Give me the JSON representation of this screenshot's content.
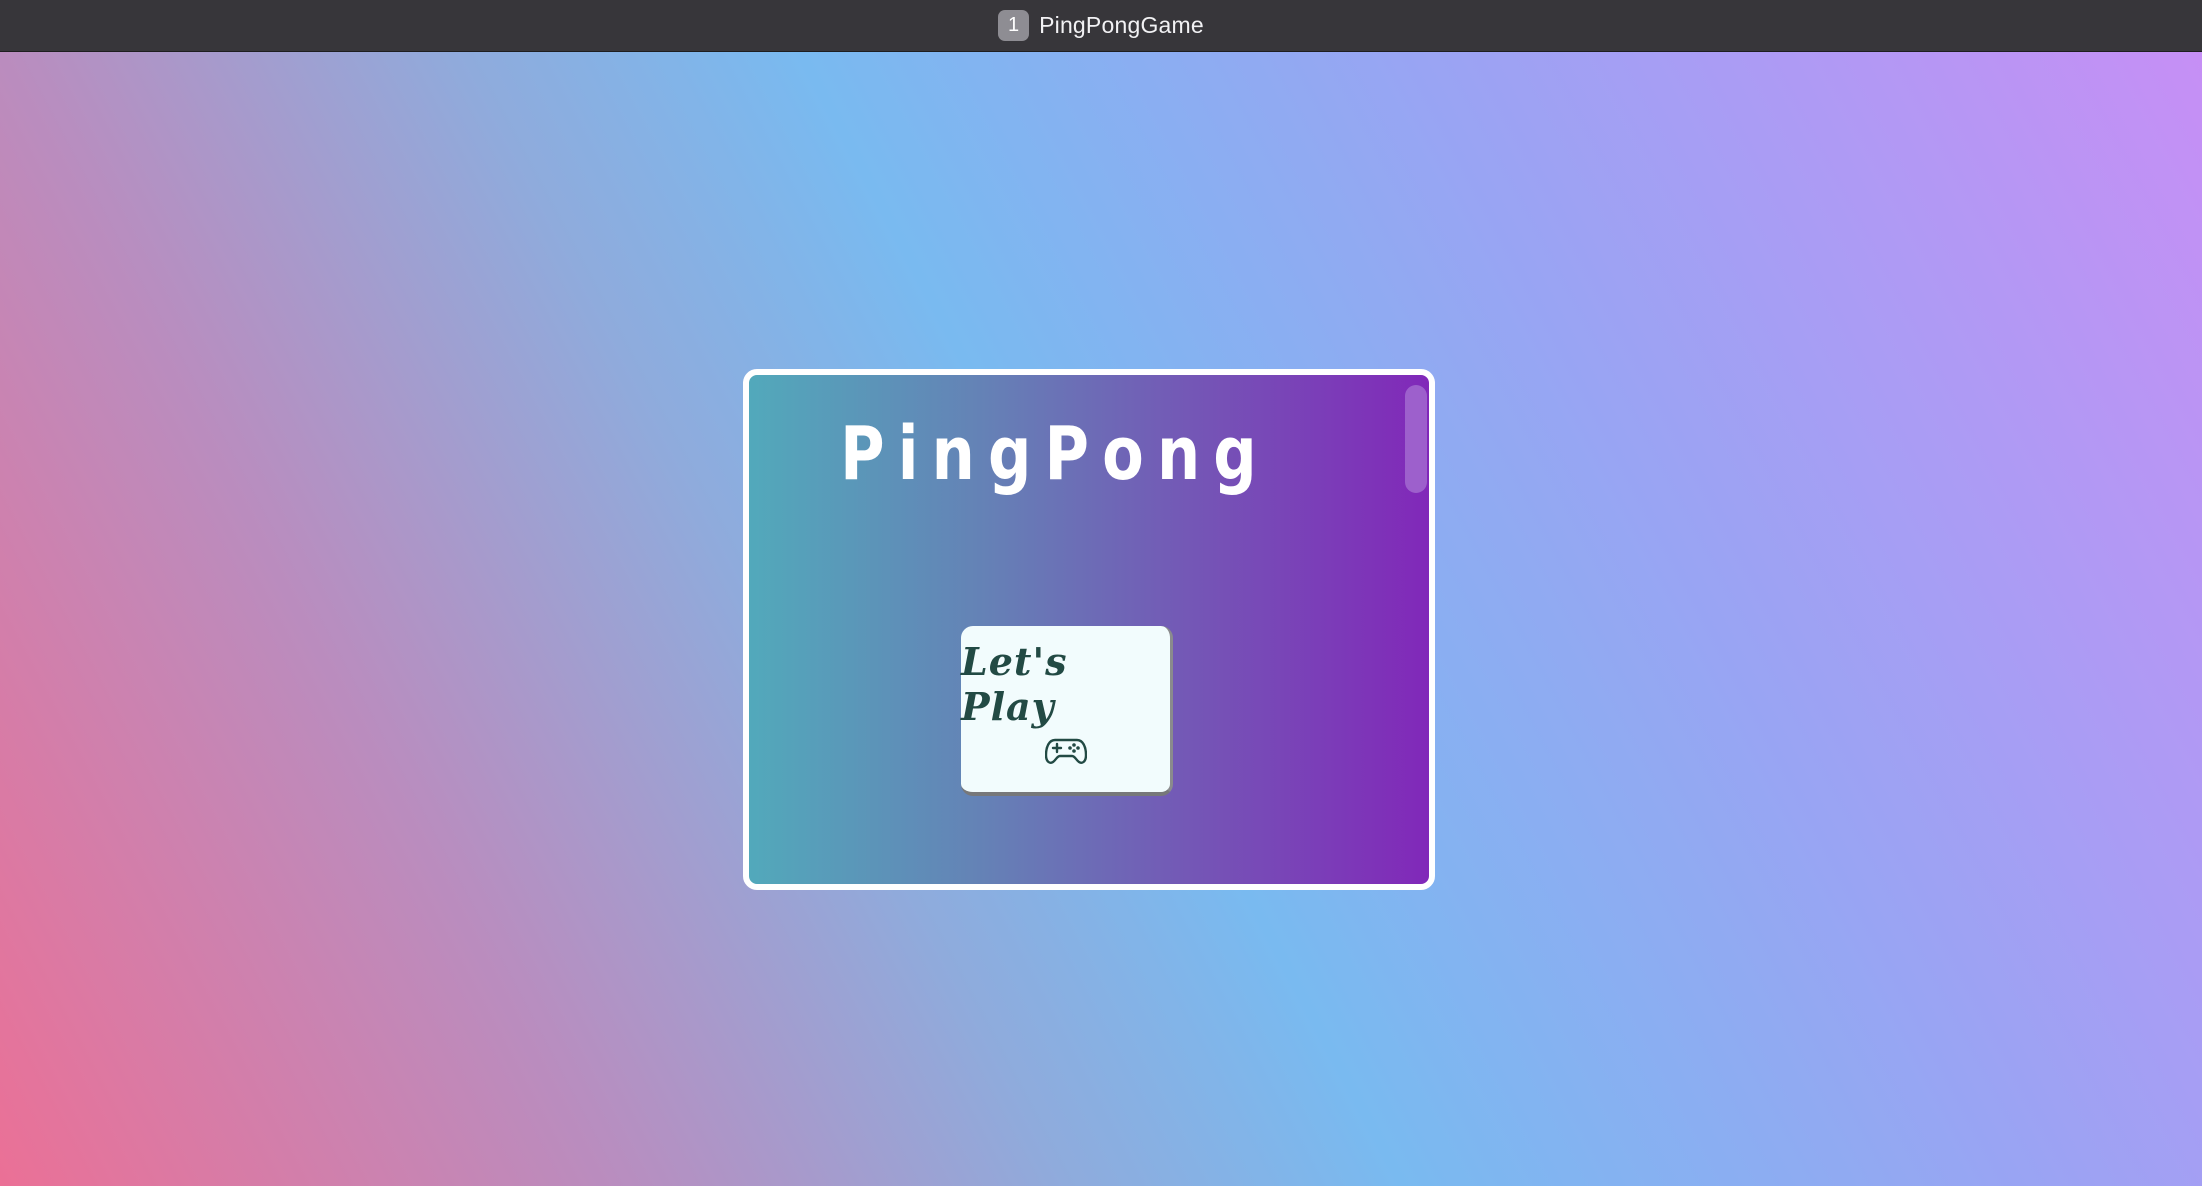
{
  "window": {
    "tab_number": "1",
    "title": "PingPongGame"
  },
  "game": {
    "title": "PingPong",
    "play_button_label": "Let's Play",
    "play_button_icon": "gamepad-icon"
  },
  "colors": {
    "titlebar": "#37363a",
    "card_gradient_start": "#52a9bb",
    "card_gradient_end": "#8128b9",
    "button_bg": "#f2fcfd",
    "button_text": "#224a44"
  }
}
